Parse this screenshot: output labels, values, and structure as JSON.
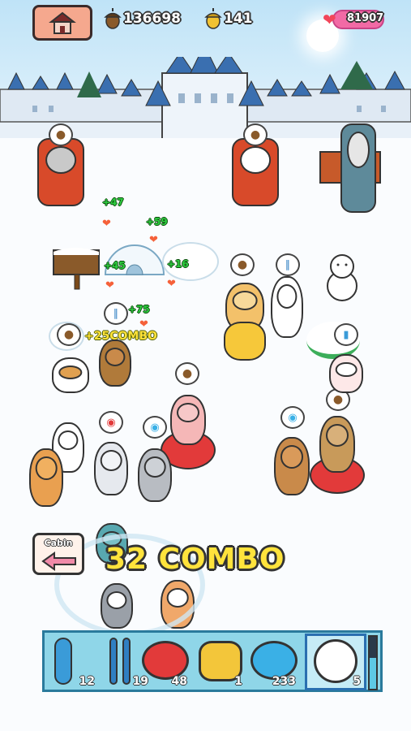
{
  "hud": {
    "home_icon": "house-icon",
    "acorns_big": "136698",
    "acorns_small": "141",
    "hearts": "81907",
    "acorn_icon": "acorn-icon",
    "golden_acorn_icon": "golden-acorn-icon"
  },
  "floating_rewards": [
    {
      "text": "+47"
    },
    {
      "text": "+59"
    },
    {
      "text": "+45"
    },
    {
      "text": "+16"
    },
    {
      "text": "+75"
    }
  ],
  "combo_popup": "+25COMBO",
  "combo_banner": "32 COMBO",
  "cabin_button": {
    "label": "Cabin",
    "icon": "arrow-left-icon"
  },
  "inventory": {
    "slots": [
      {
        "icon": "snowboard-icon",
        "count": "12",
        "color": "#3a9bd8"
      },
      {
        "icon": "skis-icon",
        "count": "19",
        "color": "#2f7fc2"
      },
      {
        "icon": "red-tube-icon",
        "count": "48",
        "color": "#e23a3a"
      },
      {
        "icon": "yellow-sled-icon",
        "count": "1",
        "color": "#f3c63a"
      },
      {
        "icon": "blue-tube-icon",
        "count": "233",
        "color": "#3ab0e6"
      },
      {
        "icon": "snowball-icon",
        "count": "5",
        "color": "#ffffff"
      }
    ],
    "selected_index": 5,
    "meter_fraction": 0.6
  },
  "colors": {
    "sky": "#bfe3f7",
    "castle": "#e8f0f8",
    "castle_roof": "#3a6fb0",
    "accent_pink": "#f26aa5",
    "combo_yellow": "#ffe33c"
  }
}
